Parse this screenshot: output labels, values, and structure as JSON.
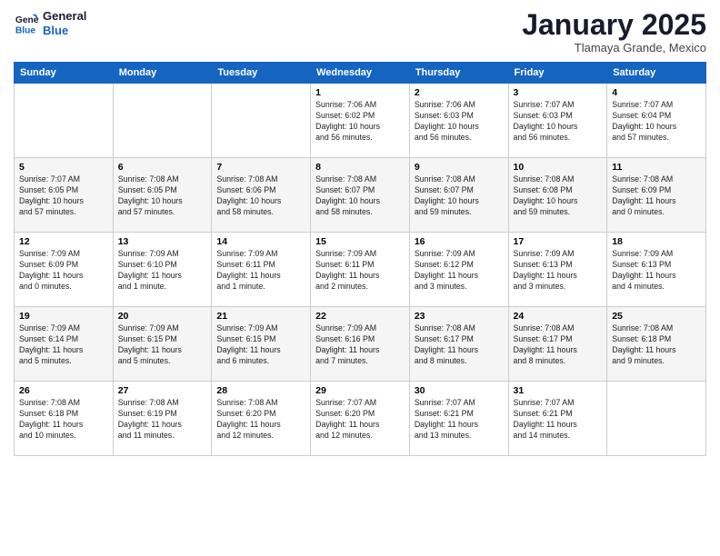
{
  "logo": {
    "line1": "General",
    "line2": "Blue"
  },
  "header": {
    "month": "January 2025",
    "location": "Tlamaya Grande, Mexico"
  },
  "weekdays": [
    "Sunday",
    "Monday",
    "Tuesday",
    "Wednesday",
    "Thursday",
    "Friday",
    "Saturday"
  ],
  "weeks": [
    [
      {
        "day": "",
        "info": ""
      },
      {
        "day": "",
        "info": ""
      },
      {
        "day": "",
        "info": ""
      },
      {
        "day": "1",
        "info": "Sunrise: 7:06 AM\nSunset: 6:02 PM\nDaylight: 10 hours\nand 56 minutes."
      },
      {
        "day": "2",
        "info": "Sunrise: 7:06 AM\nSunset: 6:03 PM\nDaylight: 10 hours\nand 56 minutes."
      },
      {
        "day": "3",
        "info": "Sunrise: 7:07 AM\nSunset: 6:03 PM\nDaylight: 10 hours\nand 56 minutes."
      },
      {
        "day": "4",
        "info": "Sunrise: 7:07 AM\nSunset: 6:04 PM\nDaylight: 10 hours\nand 57 minutes."
      }
    ],
    [
      {
        "day": "5",
        "info": "Sunrise: 7:07 AM\nSunset: 6:05 PM\nDaylight: 10 hours\nand 57 minutes."
      },
      {
        "day": "6",
        "info": "Sunrise: 7:08 AM\nSunset: 6:05 PM\nDaylight: 10 hours\nand 57 minutes."
      },
      {
        "day": "7",
        "info": "Sunrise: 7:08 AM\nSunset: 6:06 PM\nDaylight: 10 hours\nand 58 minutes."
      },
      {
        "day": "8",
        "info": "Sunrise: 7:08 AM\nSunset: 6:07 PM\nDaylight: 10 hours\nand 58 minutes."
      },
      {
        "day": "9",
        "info": "Sunrise: 7:08 AM\nSunset: 6:07 PM\nDaylight: 10 hours\nand 59 minutes."
      },
      {
        "day": "10",
        "info": "Sunrise: 7:08 AM\nSunset: 6:08 PM\nDaylight: 10 hours\nand 59 minutes."
      },
      {
        "day": "11",
        "info": "Sunrise: 7:08 AM\nSunset: 6:09 PM\nDaylight: 11 hours\nand 0 minutes."
      }
    ],
    [
      {
        "day": "12",
        "info": "Sunrise: 7:09 AM\nSunset: 6:09 PM\nDaylight: 11 hours\nand 0 minutes."
      },
      {
        "day": "13",
        "info": "Sunrise: 7:09 AM\nSunset: 6:10 PM\nDaylight: 11 hours\nand 1 minute."
      },
      {
        "day": "14",
        "info": "Sunrise: 7:09 AM\nSunset: 6:11 PM\nDaylight: 11 hours\nand 1 minute."
      },
      {
        "day": "15",
        "info": "Sunrise: 7:09 AM\nSunset: 6:11 PM\nDaylight: 11 hours\nand 2 minutes."
      },
      {
        "day": "16",
        "info": "Sunrise: 7:09 AM\nSunset: 6:12 PM\nDaylight: 11 hours\nand 3 minutes."
      },
      {
        "day": "17",
        "info": "Sunrise: 7:09 AM\nSunset: 6:13 PM\nDaylight: 11 hours\nand 3 minutes."
      },
      {
        "day": "18",
        "info": "Sunrise: 7:09 AM\nSunset: 6:13 PM\nDaylight: 11 hours\nand 4 minutes."
      }
    ],
    [
      {
        "day": "19",
        "info": "Sunrise: 7:09 AM\nSunset: 6:14 PM\nDaylight: 11 hours\nand 5 minutes."
      },
      {
        "day": "20",
        "info": "Sunrise: 7:09 AM\nSunset: 6:15 PM\nDaylight: 11 hours\nand 5 minutes."
      },
      {
        "day": "21",
        "info": "Sunrise: 7:09 AM\nSunset: 6:15 PM\nDaylight: 11 hours\nand 6 minutes."
      },
      {
        "day": "22",
        "info": "Sunrise: 7:09 AM\nSunset: 6:16 PM\nDaylight: 11 hours\nand 7 minutes."
      },
      {
        "day": "23",
        "info": "Sunrise: 7:08 AM\nSunset: 6:17 PM\nDaylight: 11 hours\nand 8 minutes."
      },
      {
        "day": "24",
        "info": "Sunrise: 7:08 AM\nSunset: 6:17 PM\nDaylight: 11 hours\nand 8 minutes."
      },
      {
        "day": "25",
        "info": "Sunrise: 7:08 AM\nSunset: 6:18 PM\nDaylight: 11 hours\nand 9 minutes."
      }
    ],
    [
      {
        "day": "26",
        "info": "Sunrise: 7:08 AM\nSunset: 6:18 PM\nDaylight: 11 hours\nand 10 minutes."
      },
      {
        "day": "27",
        "info": "Sunrise: 7:08 AM\nSunset: 6:19 PM\nDaylight: 11 hours\nand 11 minutes."
      },
      {
        "day": "28",
        "info": "Sunrise: 7:08 AM\nSunset: 6:20 PM\nDaylight: 11 hours\nand 12 minutes."
      },
      {
        "day": "29",
        "info": "Sunrise: 7:07 AM\nSunset: 6:20 PM\nDaylight: 11 hours\nand 12 minutes."
      },
      {
        "day": "30",
        "info": "Sunrise: 7:07 AM\nSunset: 6:21 PM\nDaylight: 11 hours\nand 13 minutes."
      },
      {
        "day": "31",
        "info": "Sunrise: 7:07 AM\nSunset: 6:21 PM\nDaylight: 11 hours\nand 14 minutes."
      },
      {
        "day": "",
        "info": ""
      }
    ]
  ]
}
